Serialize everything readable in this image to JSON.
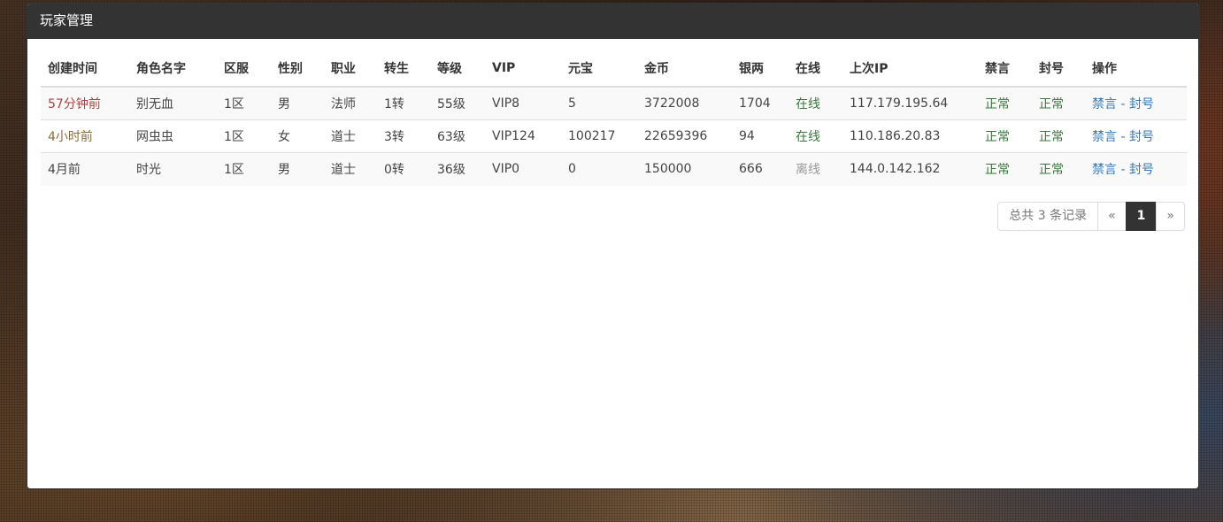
{
  "panel": {
    "title": "玩家管理"
  },
  "columns": [
    "创建时间",
    "角色名字",
    "区服",
    "性别",
    "职业",
    "转生",
    "等级",
    "VIP",
    "元宝",
    "金币",
    "银两",
    "在线",
    "上次IP",
    "禁言",
    "封号",
    "操作"
  ],
  "rows": [
    {
      "created": "57分钟前",
      "created_class": "t-danger",
      "name": "别无血",
      "server": "1区",
      "gender": "男",
      "job": "法师",
      "rebirth": "1转",
      "level": "55级",
      "vip": "VIP8",
      "yuanbao": "5",
      "gold": "3722008",
      "silver": "1704",
      "online": "在线",
      "online_class": "t-success",
      "last_ip": "117.179.195.64",
      "mute": "正常",
      "ban": "正常",
      "action_mute": "禁言",
      "action_sep": " - ",
      "action_ban": "封号"
    },
    {
      "created": "4小时前",
      "created_class": "t-warning",
      "name": "网虫虫",
      "server": "1区",
      "gender": "女",
      "job": "道士",
      "rebirth": "3转",
      "level": "63级",
      "vip": "VIP124",
      "yuanbao": "100217",
      "gold": "22659396",
      "silver": "94",
      "online": "在线",
      "online_class": "t-success",
      "last_ip": "110.186.20.83",
      "mute": "正常",
      "ban": "正常",
      "action_mute": "禁言",
      "action_sep": " - ",
      "action_ban": "封号"
    },
    {
      "created": "4月前",
      "created_class": "",
      "name": "时光",
      "server": "1区",
      "gender": "男",
      "job": "道士",
      "rebirth": "0转",
      "level": "36级",
      "vip": "VIP0",
      "yuanbao": "0",
      "gold": "150000",
      "silver": "666",
      "online": "离线",
      "online_class": "t-muted",
      "last_ip": "144.0.142.162",
      "mute": "正常",
      "ban": "正常",
      "action_mute": "禁言",
      "action_sep": " - ",
      "action_ban": "封号"
    }
  ],
  "pagination": {
    "summary": "总共 3 条记录",
    "prev": "«",
    "current": "1",
    "next": "»"
  },
  "colors": {
    "header_bg": "#333333",
    "danger": "#a94442",
    "warning": "#8a6d3b",
    "success": "#3c763d",
    "link": "#337ab7"
  }
}
